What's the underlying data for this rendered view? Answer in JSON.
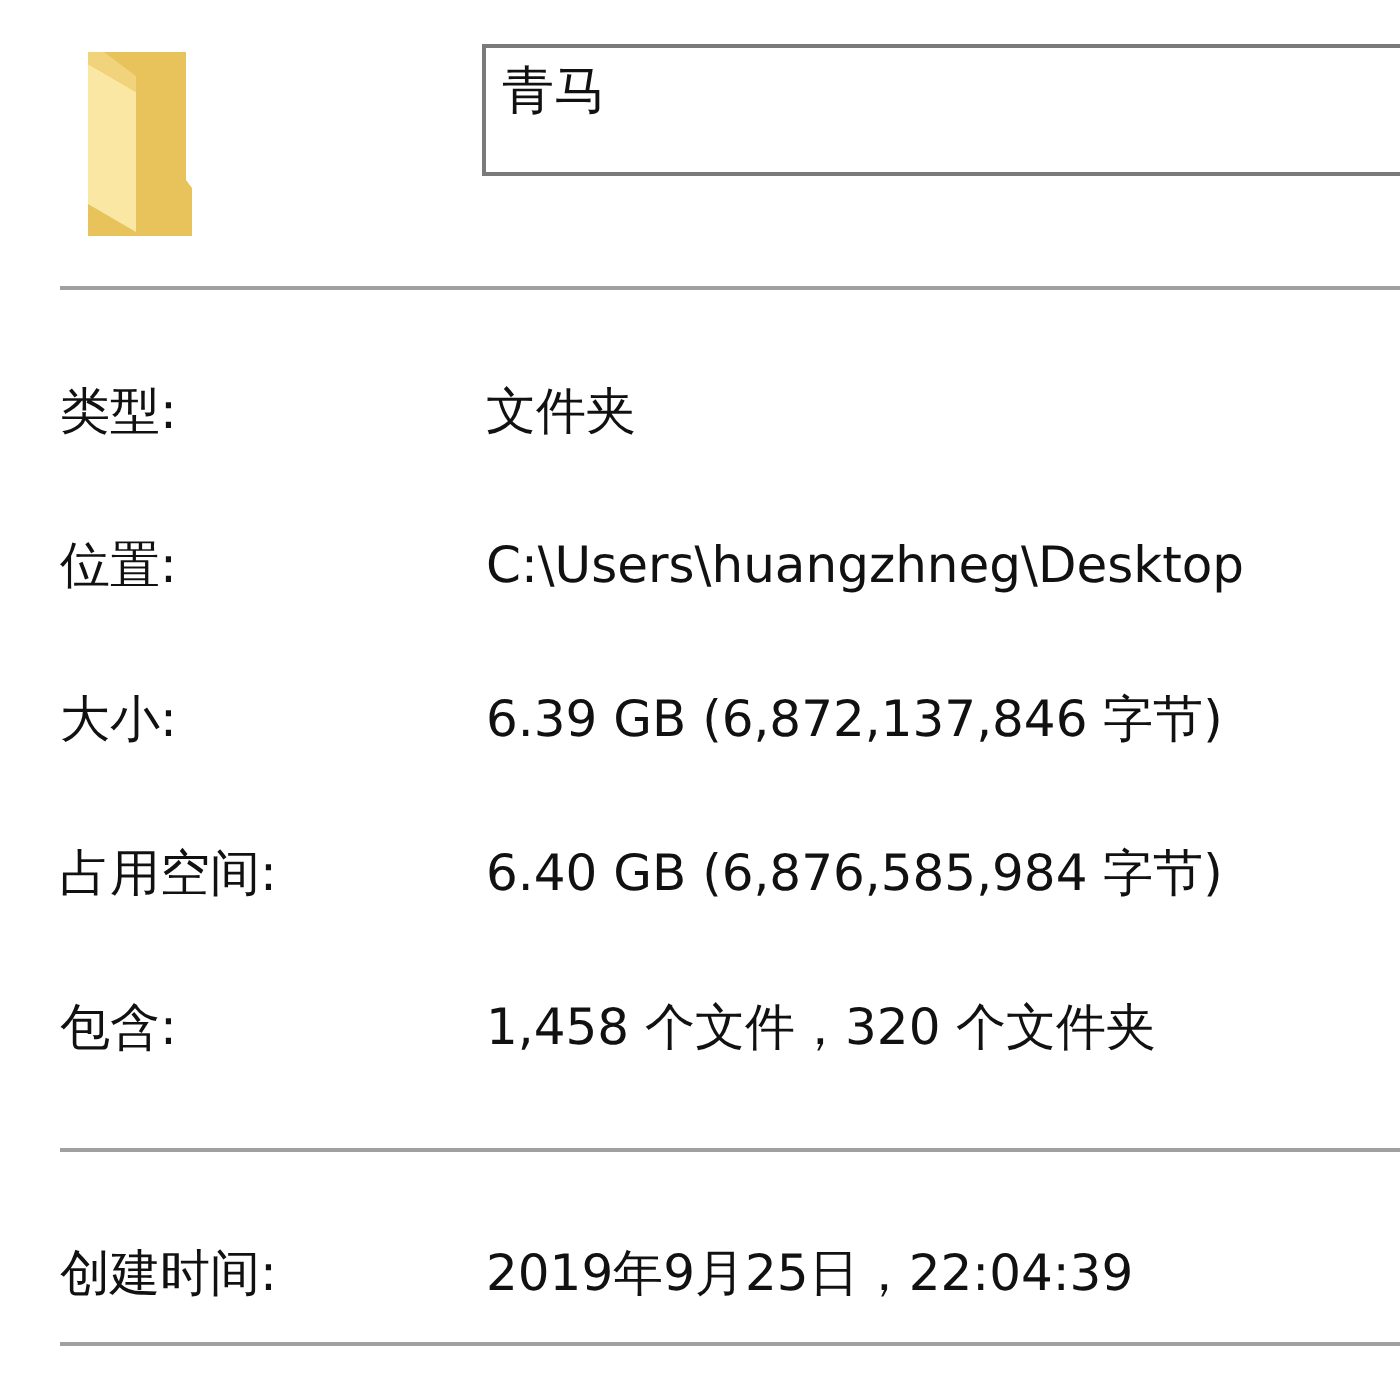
{
  "name_field": {
    "value": "青马"
  },
  "sections": [
    {
      "rows": [
        {
          "label": "类型:",
          "value": "文件夹"
        },
        {
          "label": "位置:",
          "value": "C:\\Users\\huangzhneg\\Desktop"
        },
        {
          "label": "大小:",
          "value": "6.39 GB (6,872,137,846 字节)"
        },
        {
          "label": "占用空间:",
          "value": "6.40 GB (6,876,585,984 字节)"
        },
        {
          "label": "包含:",
          "value": "1,458 个文件，320 个文件夹"
        }
      ]
    },
    {
      "rows": [
        {
          "label": "创建时间:",
          "value": "2019年9月25日，22:04:39"
        }
      ]
    }
  ]
}
